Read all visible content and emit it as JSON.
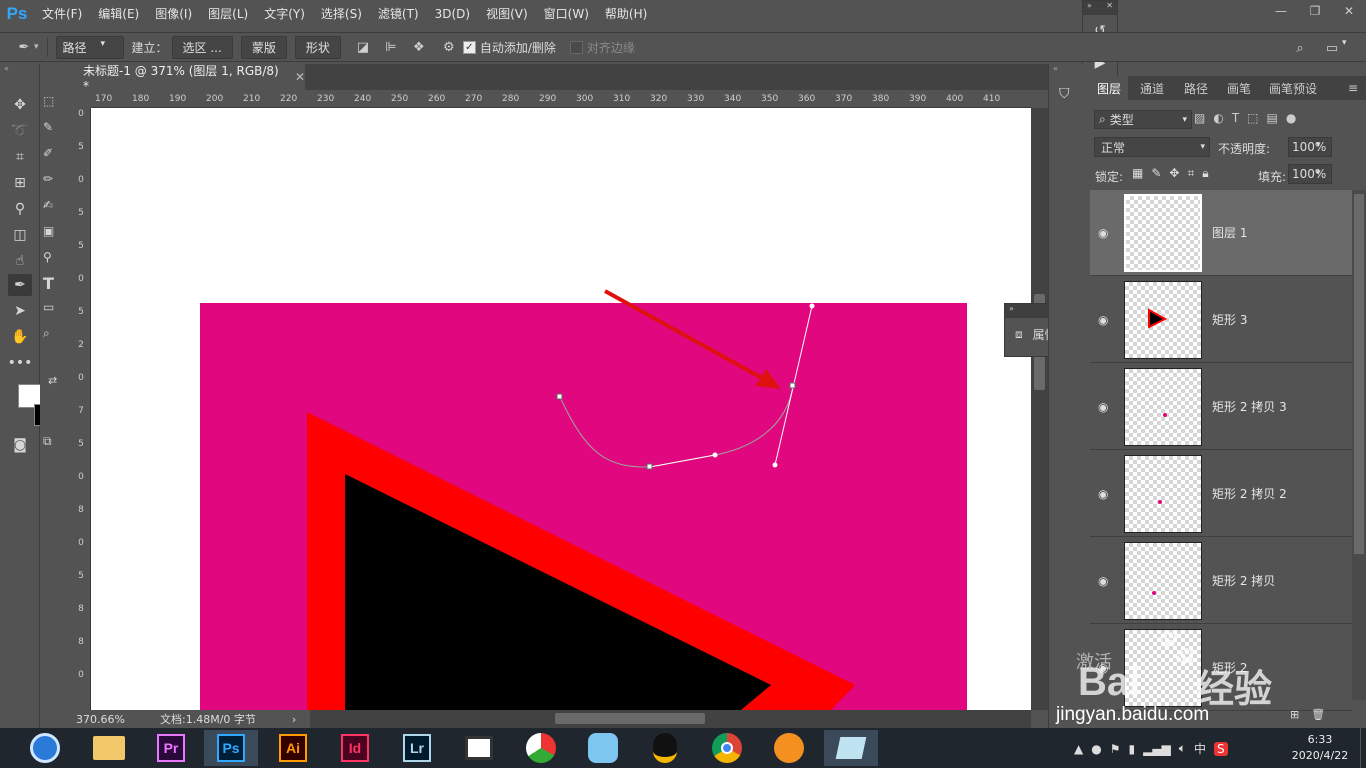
{
  "app": {
    "logo": "Ps"
  },
  "menu": [
    "文件(F)",
    "编辑(E)",
    "图像(I)",
    "图层(L)",
    "文字(Y)",
    "选择(S)",
    "滤镜(T)",
    "3D(D)",
    "视图(V)",
    "窗口(W)",
    "帮助(H)"
  ],
  "options": {
    "mode_select": "路径",
    "make_label": "建立：",
    "selection_btn": "选区 ...",
    "mask_btn": "蒙版",
    "shape_btn": "形状",
    "auto_add_delete": "自动添加/删除",
    "auto_add_checked": true,
    "align_edges": "对齐边缘",
    "align_edges_checked": false
  },
  "document_tab": {
    "title": "未标题-1 @ 371% (图层 1, RGB/8) *"
  },
  "ruler_top": [
    "170",
    "180",
    "190",
    "200",
    "210",
    "220",
    "230",
    "240",
    "250",
    "260",
    "270",
    "280",
    "290",
    "300",
    "310",
    "320",
    "330",
    "340",
    "350",
    "360",
    "370",
    "380",
    "390",
    "400",
    "410"
  ],
  "ruler_left": [
    "0",
    "5",
    "0",
    "5",
    "5",
    "0",
    "5",
    "2",
    "0",
    "7",
    "5",
    "0",
    "8",
    "0",
    "5",
    "8",
    "8",
    "0"
  ],
  "status": {
    "zoom": "370.66%",
    "doc_info": "文档:1.48M/0 字节",
    "arrow": "›"
  },
  "properties_panel": {
    "label": "属性"
  },
  "layers_panel": {
    "tabs": [
      "图层",
      "通道",
      "路径",
      "画笔",
      "画笔预设"
    ],
    "filter_kind": "类型",
    "blend_mode": "正常",
    "opacity_label": "不透明度:",
    "opacity_value": "100%",
    "lock_label": "锁定:",
    "fill_label": "填充:",
    "fill_value": "100%",
    "layers": [
      {
        "name": "图层 1",
        "selected": true
      },
      {
        "name": "矩形 3",
        "selected": false
      },
      {
        "name": "矩形 2 拷贝 3",
        "selected": false
      },
      {
        "name": "矩形 2 拷贝 2",
        "selected": false
      },
      {
        "name": "矩形 2 拷贝",
        "selected": false
      },
      {
        "name": "矩形 2",
        "selected": false
      }
    ]
  },
  "taskbar": {
    "apps": [
      "Pr",
      "Ps",
      "Ai",
      "Id",
      "Lr"
    ],
    "time": "6:33",
    "date": "2020/4/22",
    "ime": "中"
  },
  "watermark": {
    "line1": "激活",
    "brand": "Bai",
    "brand_cn": "经验",
    "url": "jingyan.baidu.com"
  },
  "colors": {
    "magenta": "#e0077f",
    "red": "#ff0000",
    "black": "#000000",
    "panel_bg": "#535353"
  }
}
